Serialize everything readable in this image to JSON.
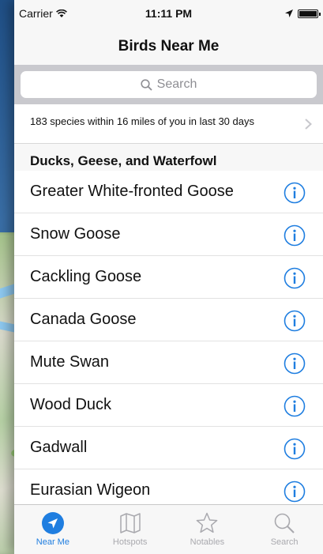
{
  "status_bar": {
    "carrier": "Carrier",
    "time": "11:11 PM"
  },
  "nav": {
    "title": "Birds Near Me"
  },
  "search": {
    "placeholder": "Search"
  },
  "summary": {
    "text": "183 species within 16 miles of you in last 30 days"
  },
  "section": {
    "header": "Ducks, Geese, and Waterfowl"
  },
  "birds": [
    "Greater White-fronted Goose",
    "Snow Goose",
    "Cackling Goose",
    "Canada Goose",
    "Mute Swan",
    "Wood Duck",
    "Gadwall",
    "Eurasian Wigeon"
  ],
  "tabs": [
    {
      "label": "Near Me",
      "icon": "location-arrow-icon",
      "active": true
    },
    {
      "label": "Hotspots",
      "icon": "map-icon",
      "active": false
    },
    {
      "label": "Notables",
      "icon": "star-icon",
      "active": false
    },
    {
      "label": "Search",
      "icon": "search-icon",
      "active": false
    }
  ],
  "colors": {
    "accent": "#1f7ee0",
    "inactive": "#a9a9ae"
  }
}
